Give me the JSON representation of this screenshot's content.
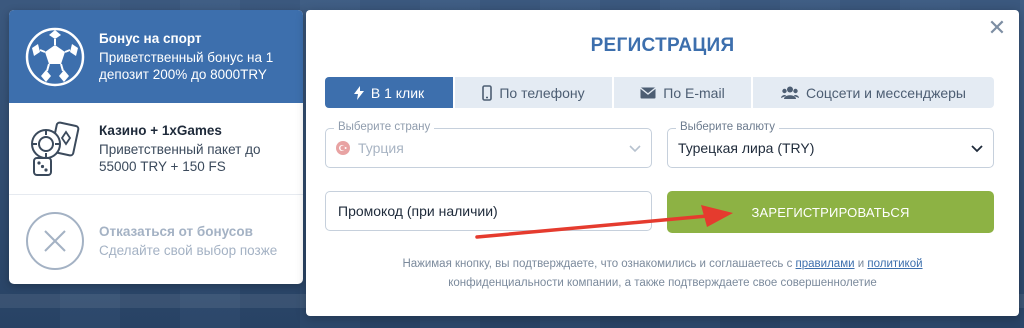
{
  "bonuses": [
    {
      "title": "Бонус на спорт",
      "desc": "Приветственный бонус на 1 депозит 200% до 8000TRY",
      "icon": "soccer-ball-icon"
    },
    {
      "title": "Казино + 1xGames",
      "desc": "Приветственный пакет до 55000 TRY + 150 FS",
      "icon": "casino-chips-icon"
    },
    {
      "title": "Отказаться от бонусов",
      "desc": "Сделайте свой выбор позже",
      "icon": "decline-x-icon"
    }
  ],
  "modal": {
    "title": "РЕГИСТРАЦИЯ",
    "close": "✕",
    "tabs": [
      {
        "label": "В 1 клик",
        "icon": "lightning-icon"
      },
      {
        "label": "По телефону",
        "icon": "phone-icon"
      },
      {
        "label": "По E-mail",
        "icon": "envelope-icon"
      },
      {
        "label": "Соцсети и мессенджеры",
        "icon": "users-icon"
      }
    ],
    "country": {
      "legend": "Выберите страну",
      "value": "Турция"
    },
    "currency": {
      "legend": "Выберите валюту",
      "value": "Турецкая лира (TRY)"
    },
    "promo_placeholder": "Промокод (при наличии)",
    "register_label": "ЗАРЕГИСТРИРОВАТЬСЯ",
    "disclaimer": {
      "part1": "Нажимая кнопку, вы подтверждаете, что ознакомились и соглашаетесь с ",
      "link_rules": "правилами",
      "part2": " и ",
      "link_policy": "политикой",
      "part3": "конфиденциальности компании, а также подтверждаете свое совершеннолетие"
    }
  },
  "colors": {
    "accent": "#3d6fad",
    "button_green": "#8db244",
    "arrow_red": "#e53b2e"
  }
}
